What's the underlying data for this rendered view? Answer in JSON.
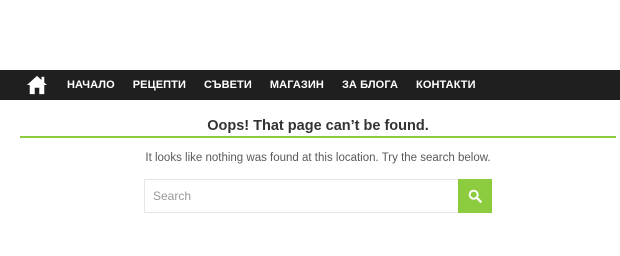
{
  "nav": {
    "home_icon": "home-icon",
    "items": [
      {
        "label": "НАЧАЛО"
      },
      {
        "label": "РЕЦЕПТИ"
      },
      {
        "label": "СЪВЕТИ"
      },
      {
        "label": "МАГАЗИН"
      },
      {
        "label": "ЗА БЛОГА"
      },
      {
        "label": "КОНТАКТИ"
      }
    ]
  },
  "main": {
    "title": "Oops! That page can’t be found.",
    "message": "It looks like nothing was found at this location. Try the search below."
  },
  "search": {
    "placeholder": "Search",
    "value": "",
    "button_icon": "search-icon"
  },
  "colors": {
    "nav_bg": "#1f1f1f",
    "accent": "#8dcc3f"
  }
}
